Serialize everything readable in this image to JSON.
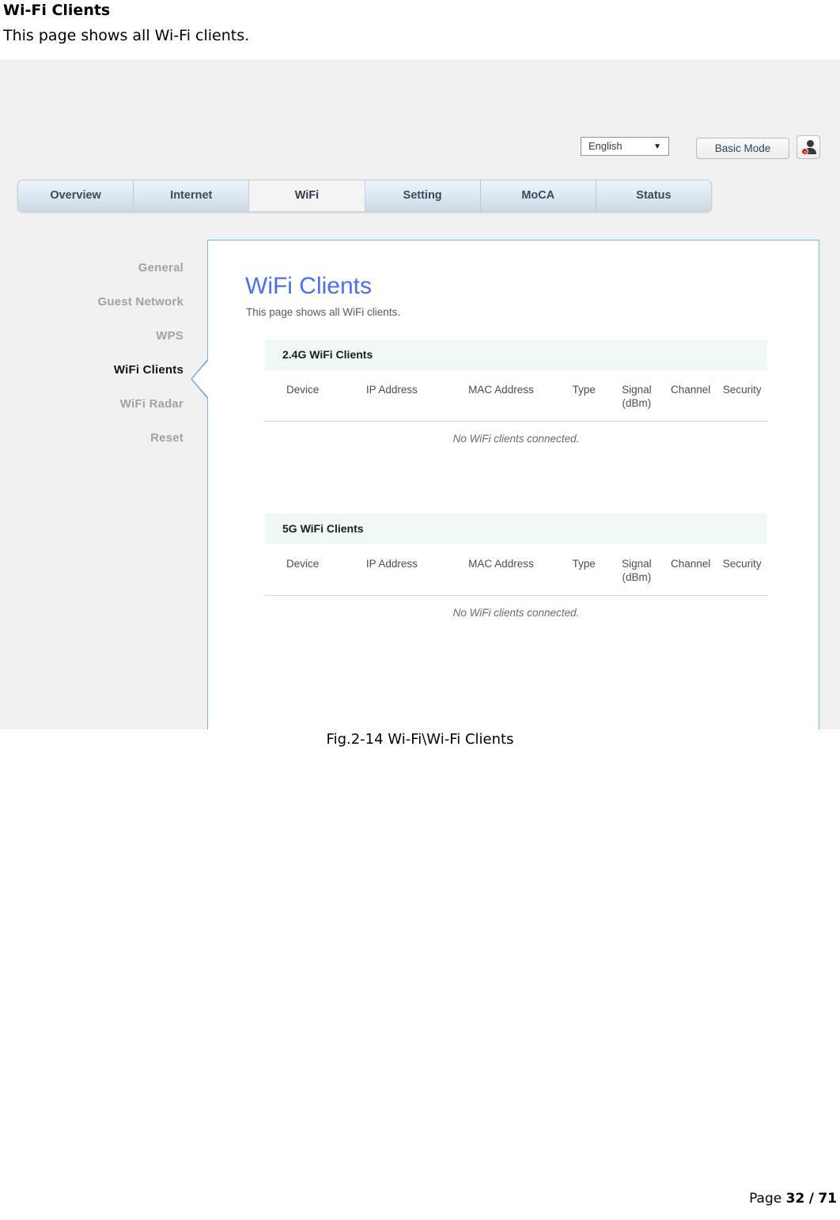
{
  "document": {
    "title": "Wi-Fi Clients",
    "subtitle": "This page shows all Wi-Fi clients.",
    "figure_caption": "Fig.2-14 Wi-Fi\\Wi-Fi Clients",
    "footer": {
      "page_label": "Page",
      "current_page": "32",
      "separator": "/",
      "total_pages": "71"
    }
  },
  "screenshot": {
    "topbar": {
      "language_select": {
        "value": "English",
        "caret_icon": "chevron-down-icon"
      },
      "mode_button": "Basic Mode",
      "user_button_icon": "user-account-icon"
    },
    "nav_tabs": [
      {
        "label": "Overview",
        "active": false
      },
      {
        "label": "Internet",
        "active": false
      },
      {
        "label": "WiFi",
        "active": true
      },
      {
        "label": "Setting",
        "active": false
      },
      {
        "label": "MoCA",
        "active": false
      },
      {
        "label": "Status",
        "active": false
      }
    ],
    "sidebar": [
      {
        "label": "General",
        "active": false
      },
      {
        "label": "Guest Network",
        "active": false
      },
      {
        "label": "WPS",
        "active": false
      },
      {
        "label": "WiFi Clients",
        "active": true
      },
      {
        "label": "WiFi Radar",
        "active": false
      },
      {
        "label": "Reset",
        "active": false
      }
    ],
    "content": {
      "title": "WiFi Clients",
      "subtitle": "This page shows all WiFi clients.",
      "table_columns": [
        "Device",
        "IP Address",
        "MAC Address",
        "Type",
        "Signal (dBm)",
        "Channel",
        "Security"
      ],
      "columns_split": {
        "device": "Device",
        "ip": "IP Address",
        "mac": "MAC Address",
        "type": "Type",
        "signal_line1": "Signal",
        "signal_line2": "(dBm)",
        "channel": "Channel",
        "security": "Security"
      },
      "sections": [
        {
          "header": "2.4G WiFi Clients",
          "empty_message": "No WiFi clients connected.",
          "rows": []
        },
        {
          "header": "5G WiFi Clients",
          "empty_message": "No WiFi clients connected.",
          "rows": []
        }
      ]
    },
    "colors": {
      "panel_border": "#77b4dc",
      "title_blue": "#4a6ff0",
      "section_header_bg": "#eff8f7",
      "page_bg": "#f1f1f1",
      "badge_red": "#e02020"
    }
  }
}
